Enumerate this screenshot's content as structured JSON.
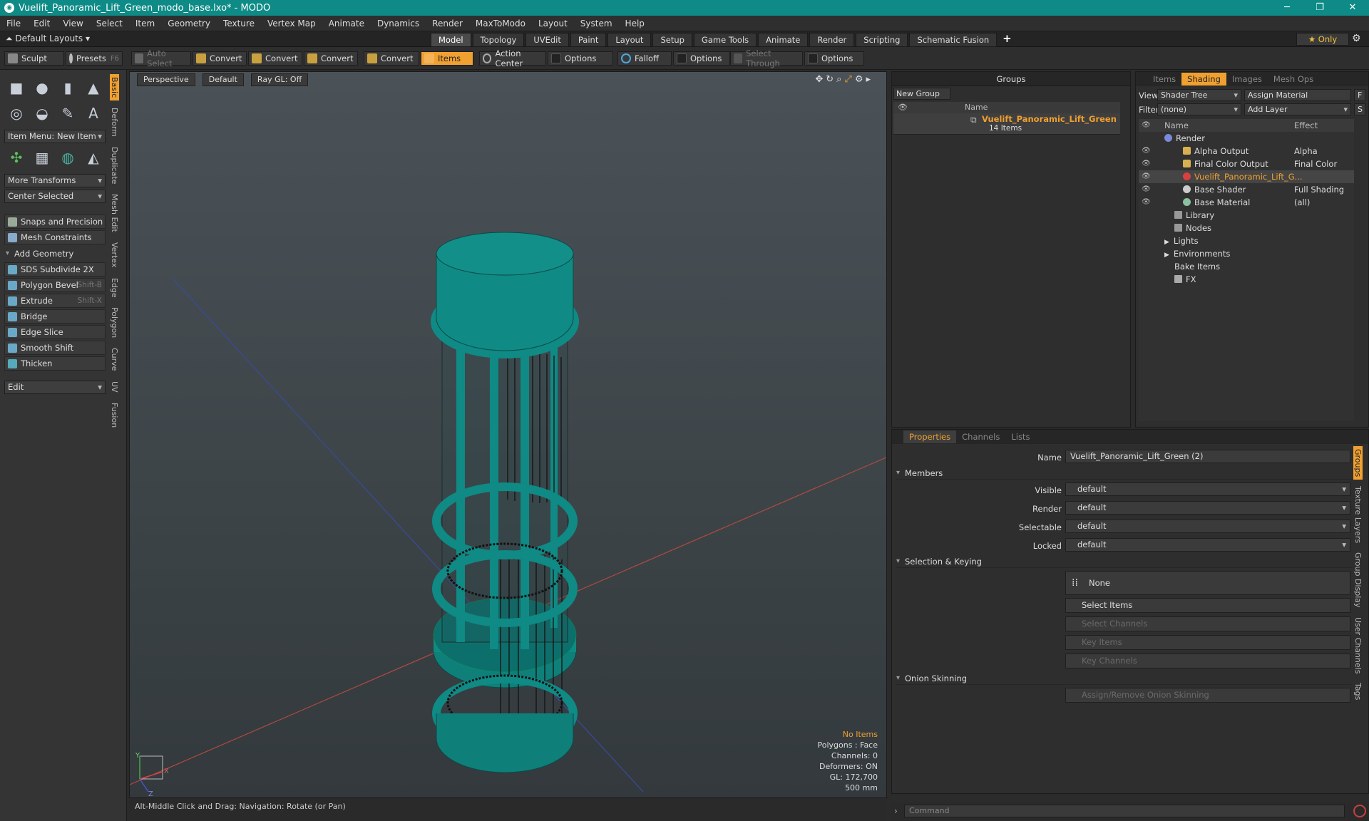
{
  "window": {
    "title": "Vuelift_Panoramic_Lift_Green_modo_base.lxo* - MODO",
    "minimize": "─",
    "maximize": "❐",
    "close": "✕"
  },
  "menu": [
    "File",
    "Edit",
    "View",
    "Select",
    "Item",
    "Geometry",
    "Texture",
    "Vertex Map",
    "Animate",
    "Dynamics",
    "Render",
    "MaxToModo",
    "Layout",
    "System",
    "Help"
  ],
  "layoutbar": {
    "default_layouts": "Default Layouts ▾",
    "tabs": [
      "Model",
      "Topology",
      "UVEdit",
      "Paint",
      "Layout",
      "Setup",
      "Game Tools",
      "Animate",
      "Render",
      "Scripting",
      "Schematic Fusion"
    ],
    "active_tab": "Model",
    "plus": "+",
    "only": "★  Only"
  },
  "toolbar": {
    "sculpt": "Sculpt",
    "presets": "Presets",
    "presets_key": "F6",
    "auto_select": "Auto Select",
    "convert": "Convert",
    "items": "Items",
    "action_center": "Action Center",
    "options": "Options",
    "falloff": "Falloff",
    "select_through": "Select Through"
  },
  "leftpanel": {
    "item_menu": "Item Menu: New Item",
    "more_transforms": "More Transforms",
    "center_selected": "Center Selected",
    "snaps": "Snaps and Precision",
    "mesh_constraints": "Mesh Constraints",
    "add_geometry": "Add Geometry",
    "tools": [
      {
        "label": "SDS Subdivide 2X",
        "shortcut": ""
      },
      {
        "label": "Polygon Bevel",
        "shortcut": "Shift-B"
      },
      {
        "label": "Extrude",
        "shortcut": "Shift-X"
      },
      {
        "label": "Bridge",
        "shortcut": ""
      },
      {
        "label": "Edge Slice",
        "shortcut": ""
      },
      {
        "label": "Smooth Shift",
        "shortcut": ""
      },
      {
        "label": "Thicken",
        "shortcut": ""
      }
    ],
    "edit": "Edit",
    "vtabs": [
      "Basic",
      "Deform",
      "Duplicate",
      "Mesh Edit",
      "Vertex",
      "Edge",
      "Polygon",
      "Curve",
      "UV",
      "Fusion"
    ],
    "active_vtab": "Basic"
  },
  "viewport": {
    "perspective": "Perspective",
    "default": "Default",
    "raygl": "Ray GL: Off",
    "stats": {
      "no_items": "No Items",
      "polygons": "Polygons : Face",
      "channels": "Channels: 0",
      "deformers": "Deformers: ON",
      "gl": "GL: 172,700",
      "scale": "500 mm"
    },
    "axis_y": "Y",
    "axis_x": "X",
    "axis_z": "Z"
  },
  "statusbar": "Alt-Middle Click and Drag:   Navigation: Rotate (or Pan)",
  "groups": {
    "title": "Groups",
    "new_group": "New Group",
    "col_name": "Name",
    "item_name": "Vuelift_Panoramic_Lift_Green",
    "item_count": "14 Items"
  },
  "shading": {
    "tabs": [
      "Items",
      "Shading",
      "Images",
      "Mesh Ops"
    ],
    "active_tab": "Shading",
    "view_label": "View",
    "view_value": "Shader Tree",
    "assign_material": "Assign Material",
    "f_btn": "F",
    "filter_label": "Filter",
    "filter_value": "(none)",
    "add_layer": "Add Layer",
    "s_btn": "S",
    "col_name": "Name",
    "col_effect": "Effect",
    "rows": [
      {
        "name": "Render",
        "effect": "",
        "indent": 1
      },
      {
        "name": "Alpha Output",
        "effect": "Alpha",
        "indent": 2
      },
      {
        "name": "Final Color Output",
        "effect": "Final Color",
        "indent": 2
      },
      {
        "name": "Vuelift_Panoramic_Lift_G...",
        "effect": "",
        "indent": 2
      },
      {
        "name": "Base Shader",
        "effect": "Full Shading",
        "indent": 2
      },
      {
        "name": "Base Material",
        "effect": "(all)",
        "indent": 2
      },
      {
        "name": "Library",
        "effect": "",
        "indent": 1
      },
      {
        "name": "Nodes",
        "effect": "",
        "indent": 1
      },
      {
        "name": "Lights",
        "effect": "",
        "indent": 1
      },
      {
        "name": "Environments",
        "effect": "",
        "indent": 1
      },
      {
        "name": "Bake Items",
        "effect": "",
        "indent": 1
      },
      {
        "name": "FX",
        "effect": "",
        "indent": 1
      }
    ]
  },
  "properties": {
    "tabs": [
      "Properties",
      "Channels",
      "Lists"
    ],
    "active_tab": "Properties",
    "name_label": "Name",
    "name_value": "Vuelift_Panoramic_Lift_Green (2)",
    "members": "Members",
    "visible_label": "Visible",
    "visible": "default",
    "render_label": "Render",
    "render": "default",
    "selectable_label": "Selectable",
    "selectable": "default",
    "locked_label": "Locked",
    "locked": "default",
    "selection_keying": "Selection & Keying",
    "none": "None",
    "select_items": "Select Items",
    "select_channels": "Select Channels",
    "key_items": "Key Items",
    "key_channels": "Key Channels",
    "onion": "Onion Skinning",
    "assign_onion": "Assign/Remove Onion Skinning",
    "rvtabs": [
      "Groups",
      "Texture Layers",
      "Group Display",
      "User Channels",
      "Tags"
    ],
    "active_rvtab": "Groups"
  },
  "command_placeholder": "Command",
  "colors": {
    "accent": "#f0a030",
    "title": "#0e8b86",
    "model": "#0f8a85",
    "wire": "#111"
  }
}
